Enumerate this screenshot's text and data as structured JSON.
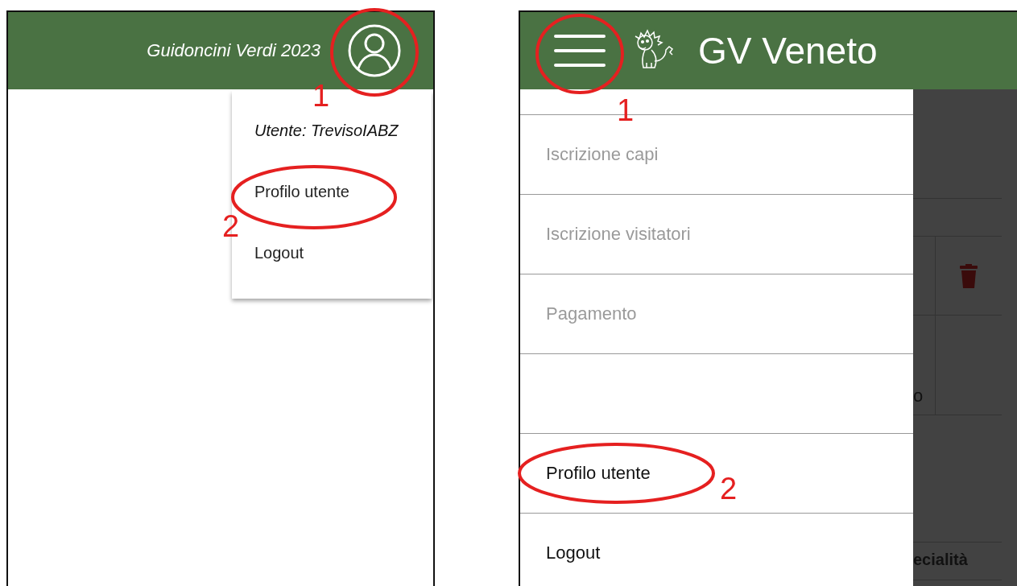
{
  "left_screen": {
    "header": {
      "title": "Guidoncini Verdi 2023"
    },
    "user_menu": {
      "open": true,
      "user_label": "Utente: TrevisoIABZ",
      "items": [
        {
          "label": "Profilo utente"
        },
        {
          "label": "Logout"
        }
      ]
    }
  },
  "right_screen": {
    "header": {
      "title": "GV Veneto"
    },
    "drawer": {
      "open": true,
      "items": [
        {
          "kind": "link",
          "label": "Iscrizione capi",
          "disabled": true
        },
        {
          "kind": "link",
          "label": "Iscrizione visitatori",
          "disabled": true
        },
        {
          "kind": "link",
          "label": "Pagamento",
          "disabled": true
        },
        {
          "kind": "spacer"
        },
        {
          "kind": "link",
          "label": "Profilo utente",
          "disabled": false
        },
        {
          "kind": "link",
          "label": "Logout",
          "disabled": false
        }
      ]
    },
    "background_page": {
      "cell_fragment": "o",
      "column_header_fragment": "ecialità"
    }
  },
  "annotations": [
    {
      "label": "1"
    },
    {
      "label": "2"
    },
    {
      "label": "1"
    },
    {
      "label": "2"
    }
  ]
}
